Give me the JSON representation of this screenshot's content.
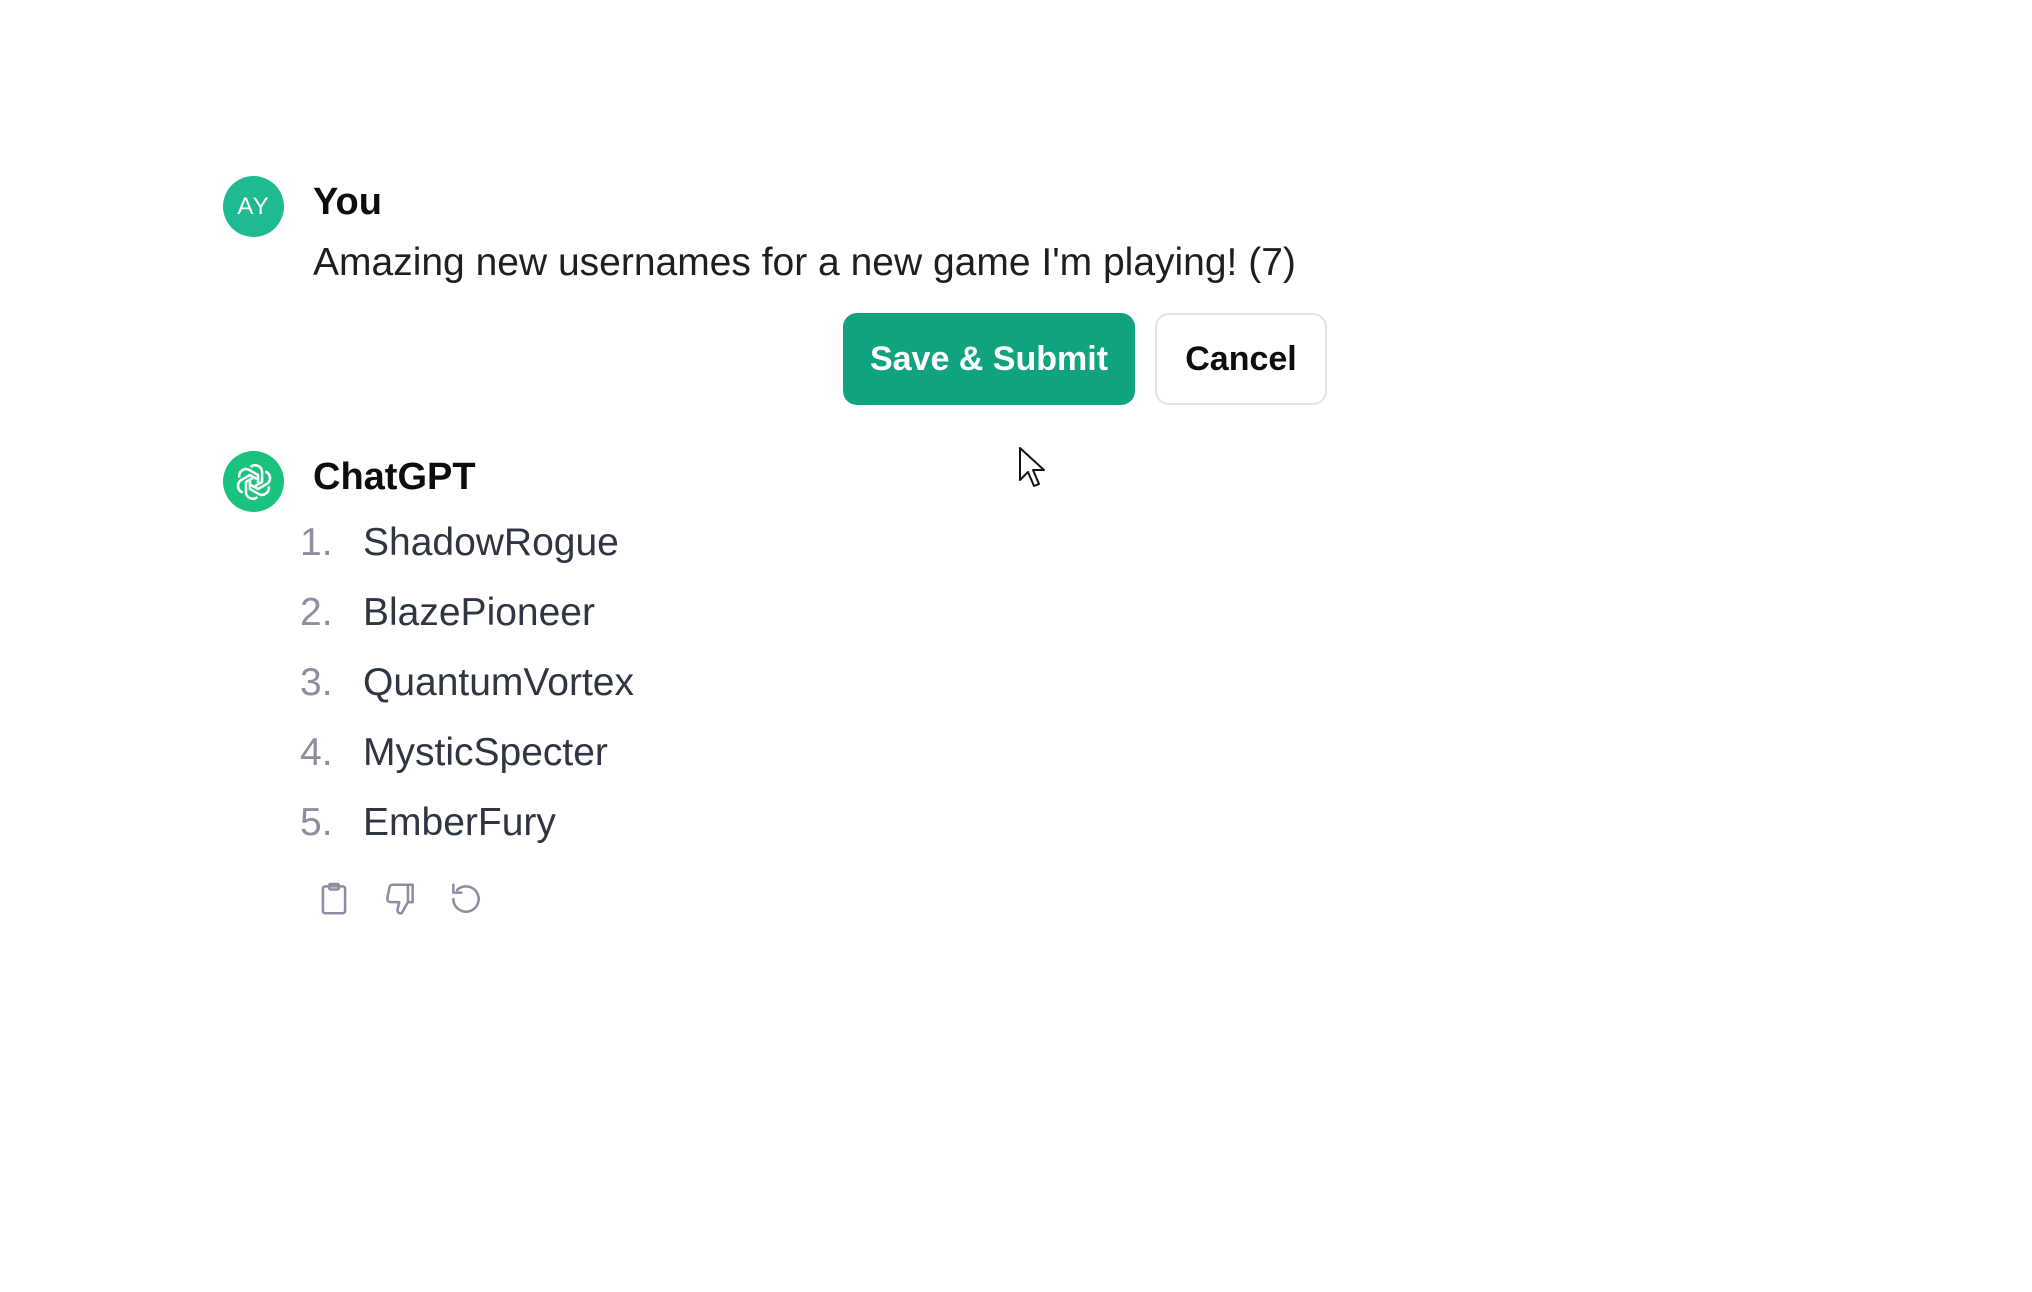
{
  "user_message": {
    "avatar_initials": "AY",
    "author": "You",
    "text": "Amazing new usernames for a new game I'm playing! (7)",
    "buttons": {
      "save_submit": "Save & Submit",
      "cancel": "Cancel"
    }
  },
  "assistant_message": {
    "author": "ChatGPT",
    "avatar_icon": "openai-logo-icon",
    "items": [
      {
        "num": "1.",
        "text": "ShadowRogue"
      },
      {
        "num": "2.",
        "text": "BlazePioneer"
      },
      {
        "num": "3.",
        "text": "QuantumVortex"
      },
      {
        "num": "4.",
        "text": "MysticSpecter"
      },
      {
        "num": "5.",
        "text": "EmberFury"
      }
    ],
    "actions": [
      "copy-icon",
      "thumbs-down-icon",
      "regenerate-icon"
    ]
  },
  "colors": {
    "accent": "#10a37f",
    "user_avatar": "#1dba93",
    "bot_avatar": "#19c37d"
  }
}
